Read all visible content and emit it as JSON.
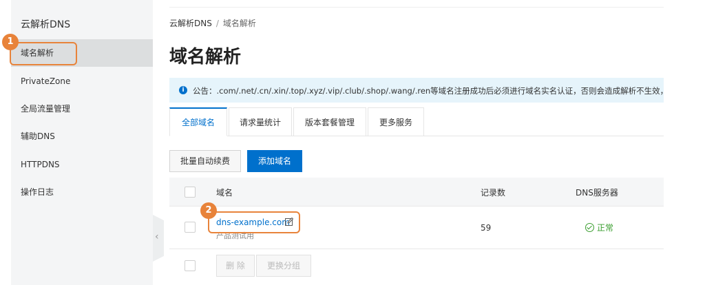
{
  "sidebar": {
    "title": "云解析DNS",
    "items": [
      {
        "label": "域名解析",
        "active": true
      },
      {
        "label": "PrivateZone",
        "active": false
      },
      {
        "label": "全局流量管理",
        "active": false
      },
      {
        "label": "辅助DNS",
        "active": false
      },
      {
        "label": "HTTPDNS",
        "active": false
      },
      {
        "label": "操作日志",
        "active": false
      }
    ]
  },
  "breadcrumb": {
    "root": "云解析DNS",
    "sep": "/",
    "current": "域名解析"
  },
  "page": {
    "title": "域名解析"
  },
  "notice": {
    "icon": "info-icon",
    "text": "公告：.com/.net/.cn/.xin/.top/.xyz/.vip/.club/.shop/.wang/.ren等域名注册成功后必须进行域名实名认证，否则会造成解析不生效，"
  },
  "tabs": [
    "全部域名",
    "请求量统计",
    "版本套餐管理",
    "更多服务"
  ],
  "toolbar": {
    "batch_renew": "批量自动续费",
    "add_domain": "添加域名"
  },
  "table": {
    "headers": {
      "domain": "域名",
      "records": "记录数",
      "dns_server": "DNS服务器"
    },
    "rows": [
      {
        "domain": "dns-example.com",
        "remark": "产品测试用",
        "records": "59",
        "status": "正常"
      }
    ]
  },
  "footer": {
    "delete": "删 除",
    "change_group": "更换分组"
  },
  "callouts": [
    "1",
    "2"
  ],
  "colors": {
    "accent": "#0070cc",
    "callout": "#e8833a",
    "success": "#3a9e2f"
  }
}
